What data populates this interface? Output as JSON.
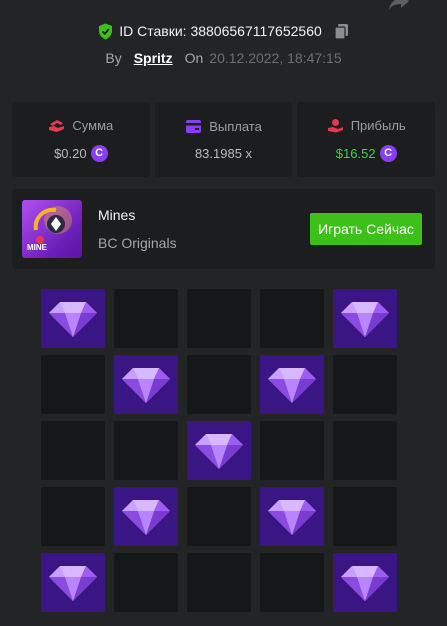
{
  "header": {
    "bet_id_label": "ID Ставки: 38806567117652560"
  },
  "byline": {
    "by_label": "By",
    "username": "Spritz",
    "on_label": "On",
    "timestamp": "20.12.2022, 18:47:15"
  },
  "stats": [
    {
      "icon": "bet-amount-icon",
      "label": "Сумма",
      "value": "$0.20",
      "color": "#e8384f"
    },
    {
      "icon": "payout-card-icon",
      "label": "Выплата",
      "value": "83.1985 x",
      "color": "#8b3df5"
    },
    {
      "icon": "profit-icon",
      "label": "Прибыль",
      "value": "$16.52",
      "color": "#e8384f"
    }
  ],
  "coin_symbol": "C",
  "game": {
    "title": "Mines",
    "subtitle": "BC Originals",
    "thumb_tag": "MINE",
    "play_label": "Играть Сейчас"
  },
  "grid": {
    "rows": 5,
    "cols": 5,
    "gems": [
      [
        1,
        0,
        0,
        0,
        1
      ],
      [
        0,
        1,
        0,
        1,
        0
      ],
      [
        0,
        0,
        1,
        0,
        0
      ],
      [
        0,
        1,
        0,
        1,
        0
      ],
      [
        1,
        0,
        0,
        0,
        1
      ]
    ]
  },
  "colors": {
    "background": "#232426",
    "panel": "#1c1d1f",
    "gem_tile": "#3a1684",
    "empty_tile": "#161718",
    "play_button": "#3bc117",
    "profit_text": "#42d14c",
    "shield": "#3bc117"
  }
}
